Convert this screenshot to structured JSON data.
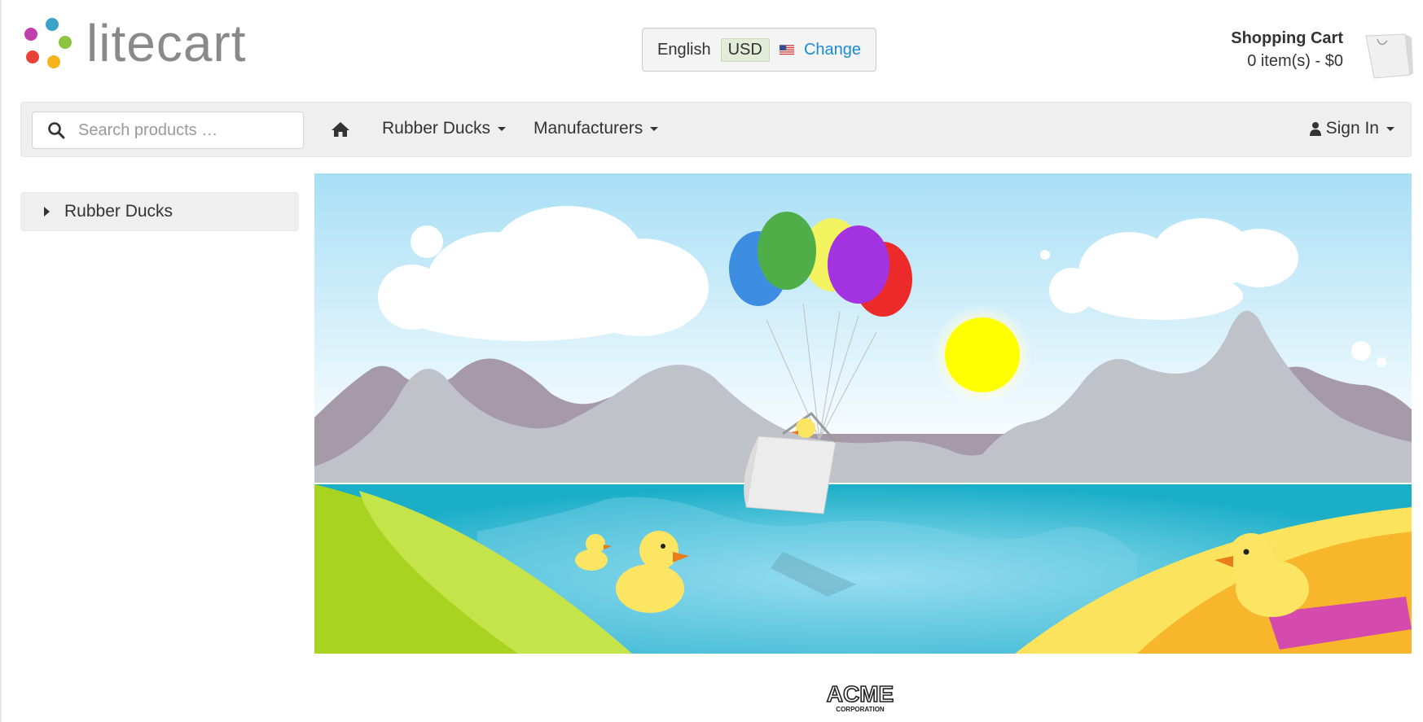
{
  "logo": {
    "text": "litecart",
    "dot_colors": [
      "#3aa3c9",
      "#c23dad",
      "#8bc43f",
      "#e94236",
      "#f6b31c"
    ]
  },
  "region": {
    "language": "English",
    "currency": "USD",
    "flag": "us-flag-icon",
    "change_label": "Change",
    "change_color": "#1a8bd6"
  },
  "cart": {
    "title": "Shopping Cart",
    "summary": "0 item(s) - $0",
    "icon": "shopping-bag-icon"
  },
  "navbar": {
    "search_placeholder": "Search products …",
    "home_icon": "home-icon",
    "items": [
      {
        "label": "Rubber Ducks"
      },
      {
        "label": "Manufacturers"
      }
    ],
    "signin_label": "Sign In"
  },
  "sidebar": {
    "categories": [
      {
        "label": "Rubber Ducks"
      }
    ]
  },
  "banner": {
    "description_icon": "banner-illustration"
  },
  "footer": {
    "manufacturer_logo": "ACME",
    "manufacturer_sub": "CORPORATION"
  }
}
